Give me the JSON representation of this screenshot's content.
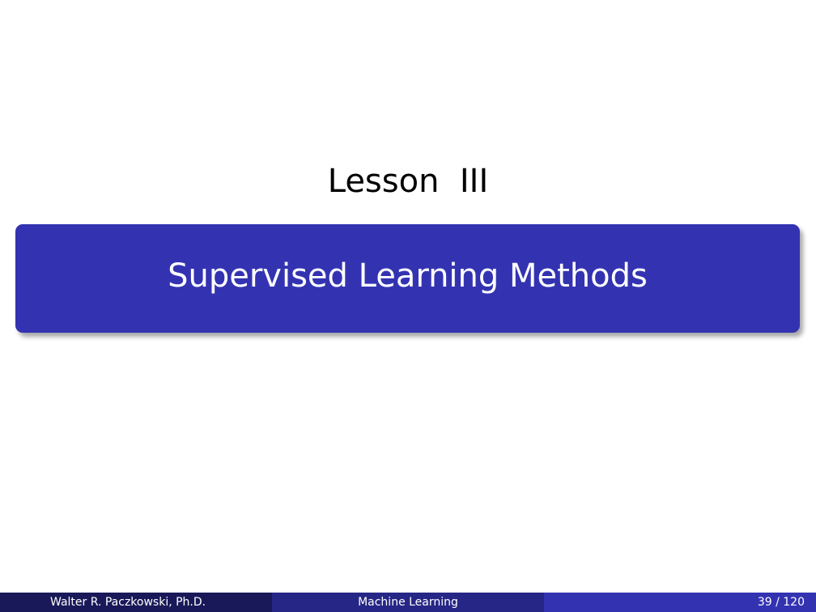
{
  "slide": {
    "lesson_heading": "Lesson  III",
    "title": "Supervised Learning Methods"
  },
  "footer": {
    "author": "Walter R. Paczkowski, Ph.D.",
    "course": "Machine Learning",
    "page_number": "39 / 120"
  },
  "colors": {
    "title_box": "#3333b2",
    "footer_left": "#191959",
    "footer_middle": "#262686",
    "footer_right": "#3333b2"
  }
}
